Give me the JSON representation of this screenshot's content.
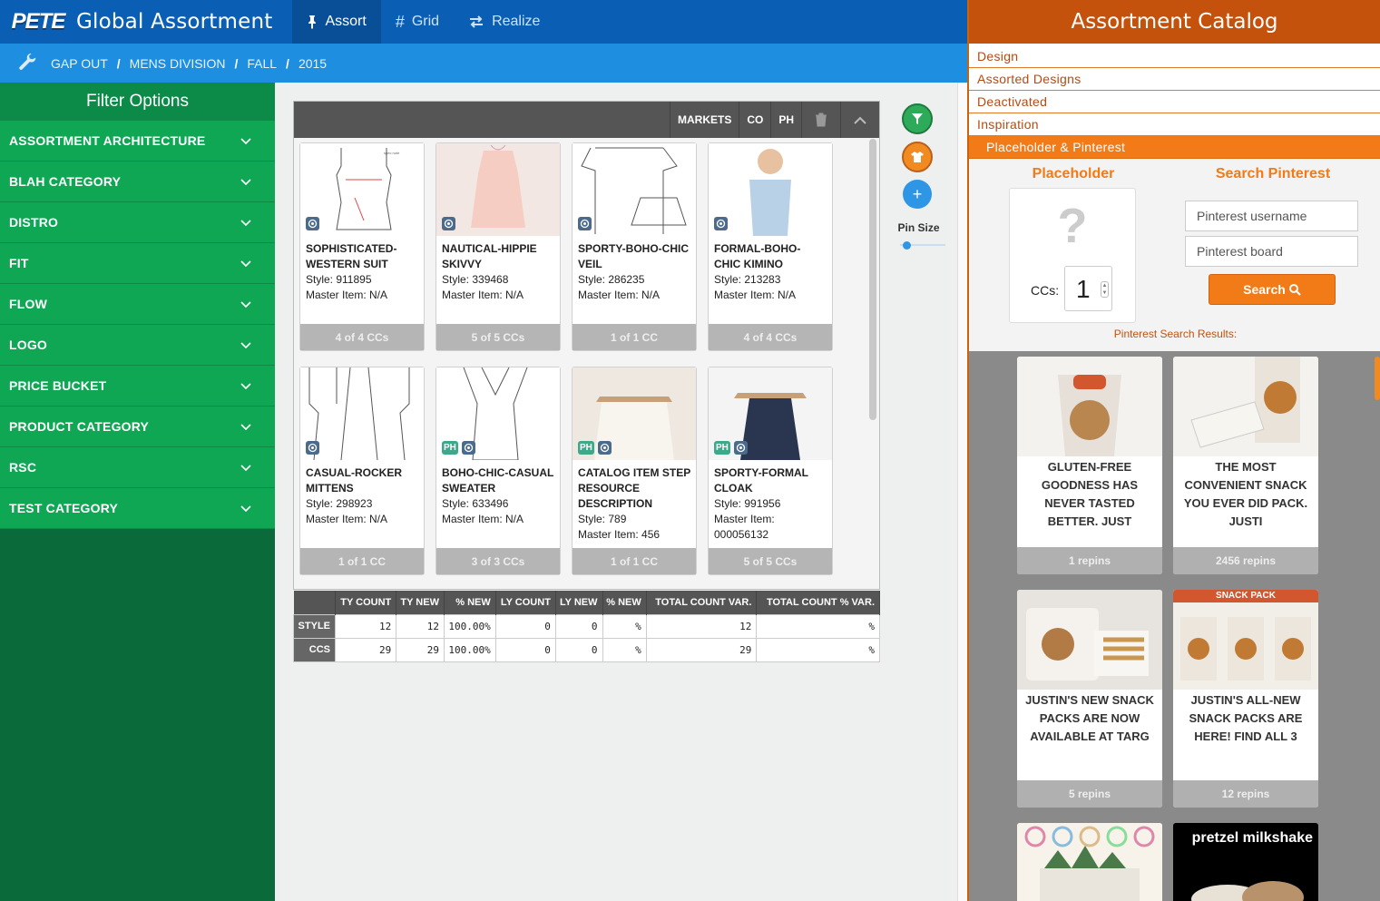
{
  "header": {
    "logo": "PETE",
    "app_title": "Global Assortment",
    "tabs": [
      {
        "label": "Assort",
        "active": true
      },
      {
        "label": "Grid",
        "active": false
      },
      {
        "label": "Realize",
        "active": false
      }
    ]
  },
  "breadcrumb": [
    "GAP OUT",
    "MENS DIVISION",
    "FALL",
    "2015"
  ],
  "sidebar": {
    "title": "Filter Options",
    "items": [
      "ASSORTMENT ARCHITECTURE",
      "BLAH CATEGORY",
      "DISTRO",
      "FIT",
      "FLOW",
      "LOGO",
      "PRICE BUCKET",
      "PRODUCT CATEGORY",
      "RSC",
      "TEST CATEGORY"
    ]
  },
  "panel": {
    "buttons": {
      "markets": "MARKETS",
      "co": "CO",
      "ph": "PH"
    },
    "cards": [
      {
        "name": "SOPHISTICATED-WESTERN SUIT",
        "style": "Style: 911895",
        "master": "Master Item: N/A",
        "ccs": "4 of 4  CCs"
      },
      {
        "name": "NAUTICAL-HIPPIE SKIVVY",
        "style": "Style: 339468",
        "master": "Master Item: N/A",
        "ccs": "5 of 5  CCs"
      },
      {
        "name": "SPORTY-BOHO-CHIC VEIL",
        "style": "Style: 286235",
        "master": "Master Item: N/A",
        "ccs": "1 of 1  CC"
      },
      {
        "name": "FORMAL-BOHO-CHIC KIMINO",
        "style": "Style: 213283",
        "master": "Master Item: N/A",
        "ccs": "4 of 4  CCs"
      },
      {
        "name": "CASUAL-ROCKER MITTENS",
        "style": "Style: 298923",
        "master": "Master Item: N/A",
        "ccs": "1 of 1  CC"
      },
      {
        "name": "BOHO-CHIC-CASUAL SWEATER",
        "style": "Style: 633496",
        "master": "Master Item: N/A",
        "ccs": "3 of 3  CCs"
      },
      {
        "name": "CATALOG ITEM STEP RESOURCE DESCRIPTION",
        "style": "Style: 789",
        "master": "Master Item: 456",
        "ccs": "1 of 1  CC"
      },
      {
        "name": "SPORTY-FORMAL CLOAK",
        "style": "Style: 991956",
        "master": "Master Item: 000056132",
        "ccs": "5 of 5  CCs"
      }
    ],
    "ph_badge": "PH"
  },
  "stats": {
    "headers": [
      "TY COUNT",
      "TY NEW",
      "% NEW",
      "LY COUNT",
      "LY NEW",
      "% NEW",
      "TOTAL COUNT VAR.",
      "TOTAL COUNT % VAR."
    ],
    "rows": [
      {
        "label": "STYLE",
        "values": [
          "12",
          "12",
          "100.00%",
          "0",
          "0",
          "%",
          "12",
          "%"
        ]
      },
      {
        "label": "CCS",
        "values": [
          "29",
          "29",
          "100.00%",
          "0",
          "0",
          "%",
          "29",
          "%"
        ]
      }
    ]
  },
  "tools": {
    "pin_size_label": "Pin Size",
    "pin_size_value": 0.05
  },
  "catalog": {
    "title": "Assortment Catalog",
    "items": [
      "Design",
      "Assorted Designs",
      "Deactivated",
      "Inspiration",
      "Placeholder & Pinterest"
    ],
    "placeholder_title": "Placeholder",
    "placeholder_glyph": "?",
    "ccs_label": "CCs:",
    "ccs_value": "1",
    "pinterest_title": "Search Pinterest",
    "username_placeholder": "Pinterest username",
    "board_placeholder": "Pinterest board",
    "search_label": "Search",
    "results_label": "Pinterest Search Results:",
    "pins": [
      {
        "text": "GLUTEN-FREE GOODNESS HAS NEVER TASTED BETTER. JUST",
        "repins": "1 repins"
      },
      {
        "text": "THE MOST CONVENIENT SNACK YOU EVER DID PACK. JUSTI",
        "repins": "2456 repins"
      },
      {
        "text": "JUSTIN'S NEW SNACK PACKS ARE NOW AVAILABLE AT TARG",
        "repins": "5 repins"
      },
      {
        "text": "JUSTIN'S ALL-NEW SNACK PACKS ARE HERE! FIND ALL 3",
        "repins": "12 repins"
      }
    ],
    "pin_overlay": "pretzel milkshake",
    "pin_header": "SNACK PACK"
  },
  "colors": {
    "primary": "#0a5fb4",
    "filter": "#10a754",
    "catalog": "#c4520c",
    "accent": "#f27b17"
  }
}
